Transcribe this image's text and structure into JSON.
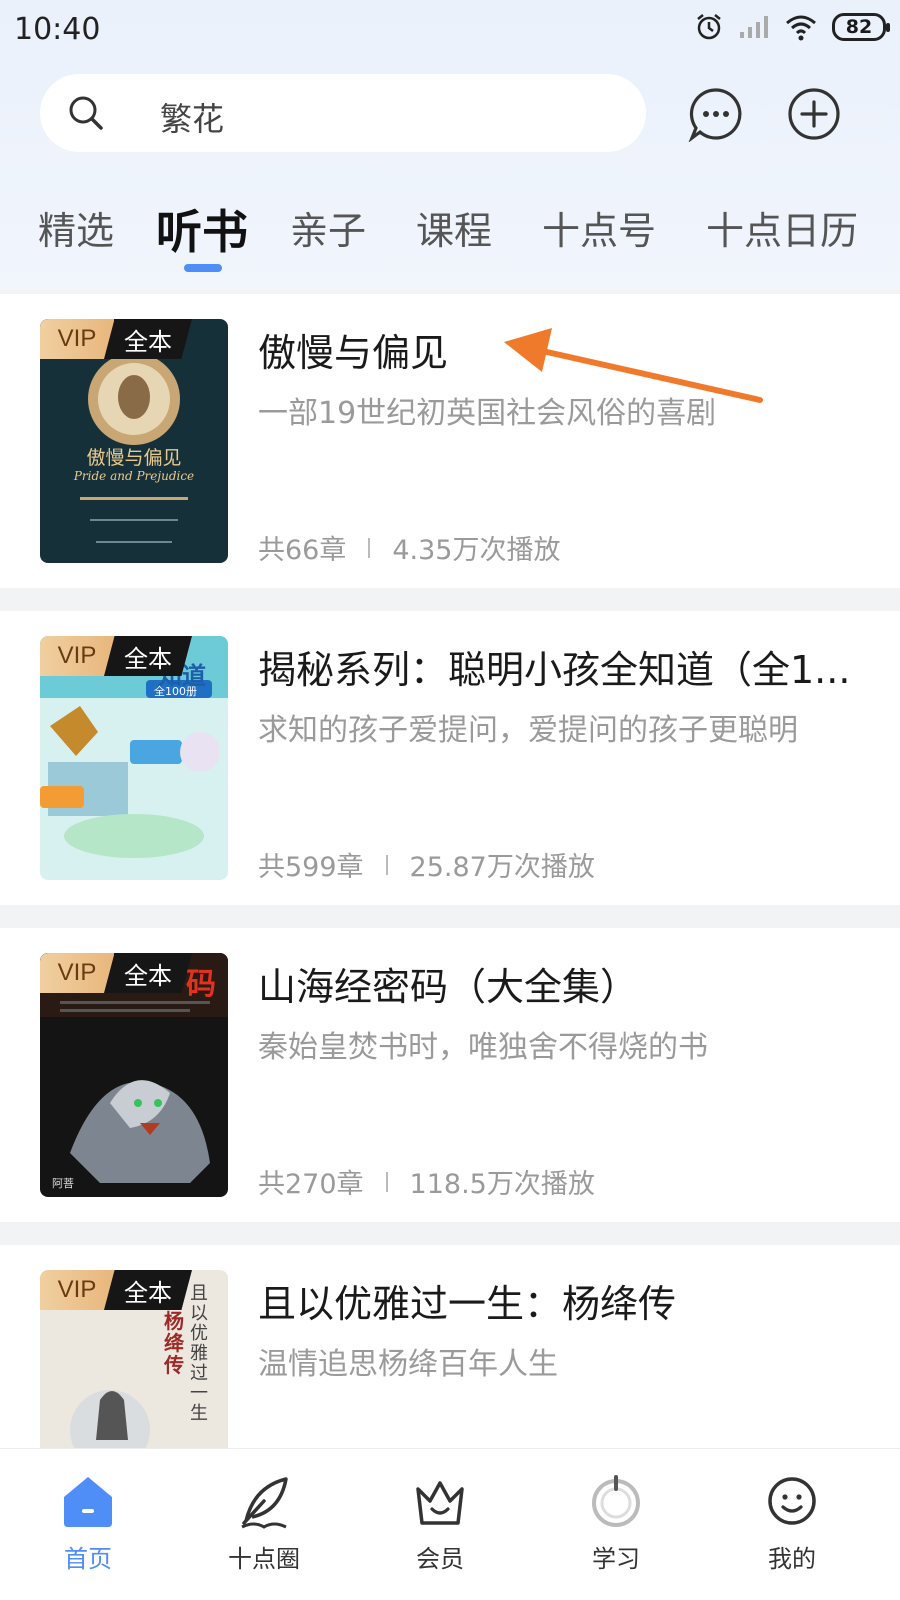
{
  "status_bar": {
    "time": "10:40",
    "battery": "82",
    "icons": [
      "alarm-icon",
      "signal-icon",
      "wifi-icon",
      "battery-icon"
    ]
  },
  "search": {
    "value": "繁花"
  },
  "header_actions": [
    "message-icon",
    "add-icon"
  ],
  "tabs": [
    {
      "label": "精选"
    },
    {
      "label": "听书",
      "active": true
    },
    {
      "label": "亲子"
    },
    {
      "label": "课程"
    },
    {
      "label": "十点号"
    },
    {
      "label": "十点日历"
    }
  ],
  "books": [
    {
      "badge_vip": "VIP",
      "badge_full": "全本",
      "title": "傲慢与偏见",
      "desc": "一部19世纪初英国社会风俗的喜剧",
      "chapters": "共66章",
      "plays": "4.35万次播放",
      "cover_title": "傲慢与偏见",
      "cover_subtitle": "Pride and Prejudice"
    },
    {
      "badge_vip": "VIP",
      "badge_full": "全本",
      "title": "揭秘系列：聪明小孩全知道（全1...",
      "desc": "求知的孩子爱提问，爱提问的孩子更聪明",
      "chapters": "共599章",
      "plays": "25.87万次播放",
      "cover_title": "知道",
      "cover_subtitle": "全100册"
    },
    {
      "badge_vip": "VIP",
      "badge_full": "全本",
      "title": "山海经密码（大全集）",
      "desc": "秦始皇焚书时，唯独舍不得烧的书",
      "chapters": "共270章",
      "plays": "118.5万次播放",
      "cover_title": "码",
      "cover_subtitle": "阿菩"
    },
    {
      "badge_vip": "VIP",
      "badge_full": "全本",
      "title": "且以优雅过一生：杨绛传",
      "desc": "温情追思杨绛百年人生",
      "cover_title": "且以优雅过一生",
      "cover_subtitle": "杨绛传"
    }
  ],
  "bottom_nav": [
    {
      "label": "首页",
      "icon": "home-icon",
      "active": true
    },
    {
      "label": "十点圈",
      "icon": "feather-icon"
    },
    {
      "label": "会员",
      "icon": "crown-icon"
    },
    {
      "label": "学习",
      "icon": "target-icon"
    },
    {
      "label": "我的",
      "icon": "smile-icon"
    }
  ],
  "colors": {
    "accent": "#4f8df7",
    "annotation_arrow": "#f07a2b",
    "vip_gold": "#e8b77c"
  }
}
